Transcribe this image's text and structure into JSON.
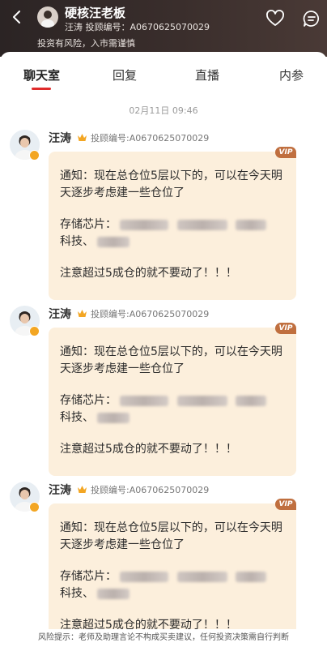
{
  "header": {
    "title": "硬核汪老板",
    "subtitle": "汪涛 投顾编号：A0670625070029",
    "risk_note": "投资有风险，入市需谨慎"
  },
  "tabs": [
    {
      "label": "聊天室",
      "active": true
    },
    {
      "label": "回复",
      "active": false
    },
    {
      "label": "直播",
      "active": false
    },
    {
      "label": "内参",
      "active": false
    }
  ],
  "timestamp": "02月11日 09:46",
  "messages": [
    {
      "name": "汪涛",
      "advisor_id": "投顾编号:A0670625070029",
      "vip": "VIP",
      "notice": "通知：现在总仓位5层以下的，可以在今天明天逐步考虑建一些仓位了",
      "chips_prefix": "存储芯片：",
      "chips_suffix": "科技、",
      "warning": "注意超过5成仓的就不要动了！！！"
    },
    {
      "name": "汪涛",
      "advisor_id": "投顾编号:A0670625070029",
      "vip": "VIP",
      "notice": "通知：现在总仓位5层以下的，可以在今天明天逐步考虑建一些仓位了",
      "chips_prefix": "存储芯片：",
      "chips_suffix": "科技、",
      "warning": "注意超过5成仓的就不要动了！！！"
    },
    {
      "name": "汪涛",
      "advisor_id": "投顾编号:A0670625070029",
      "vip": "VIP",
      "notice": "通知：现在总仓位5层以下的，可以在今天明天逐步考虑建一些仓位了",
      "chips_prefix": "存储芯片：",
      "chips_suffix": "科技、",
      "warning": "注意超过5成仓的就不要动了！！！"
    }
  ],
  "footer": {
    "risk_hint": "风险提示：老师及助理言论不构成买卖建议，任何投资决策需自行判断"
  },
  "colors": {
    "header_bg": "#2b2424",
    "bubble_bg": "#fcefdc",
    "vip_badge": "#c06f3f",
    "tab_indicator": "#e02b2b",
    "crown": "#f3a623"
  },
  "icons": [
    "back-arrow-icon",
    "heart-icon",
    "chat-icon",
    "crown-icon",
    "vip-badge"
  ]
}
